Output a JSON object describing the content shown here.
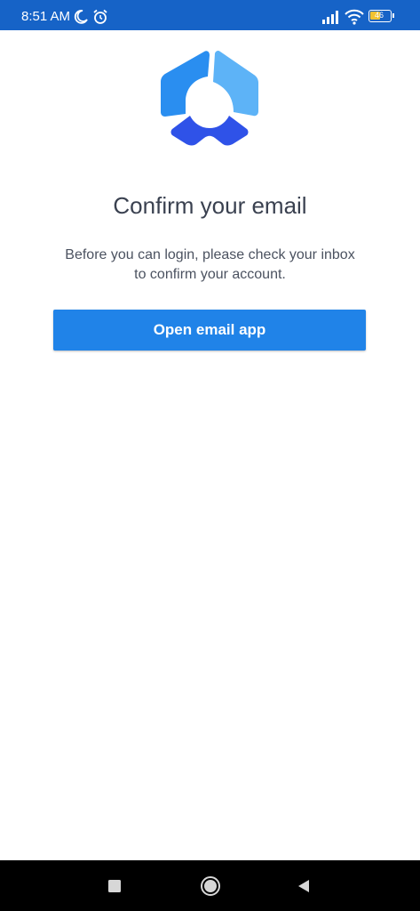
{
  "status_bar": {
    "time": "8:51 AM",
    "battery_level": "46",
    "background": "#1663c7",
    "icons": [
      "moon-icon",
      "alarm-icon",
      "signal-icon",
      "wifi-icon",
      "battery-icon"
    ]
  },
  "logo": {
    "icon": "app-logo-icon",
    "colors": [
      "#2a8ef0",
      "#5db3f7",
      "#2f52e8"
    ]
  },
  "confirm": {
    "title": "Confirm your email",
    "line1": "Before you can login, please check your inbox",
    "line2": "to confirm your account.",
    "button_label": "Open email app",
    "button_color": "#2083e8"
  },
  "nav_bar": {
    "icons": [
      "recents-square-icon",
      "home-circle-icon",
      "back-triangle-icon"
    ]
  }
}
